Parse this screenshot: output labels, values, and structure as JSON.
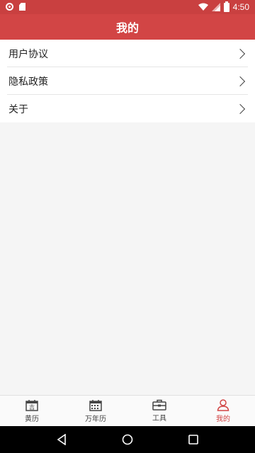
{
  "status": {
    "time": "4:50"
  },
  "header": {
    "title": "我的"
  },
  "menu": {
    "items": [
      {
        "label": "用户协议"
      },
      {
        "label": "隐私政策"
      },
      {
        "label": "关于"
      }
    ]
  },
  "tabs": [
    {
      "label": "黄历",
      "icon": "calendar-ji-icon",
      "active": false
    },
    {
      "label": "万年历",
      "icon": "calendar-grid-icon",
      "active": false
    },
    {
      "label": "工具",
      "icon": "toolbox-icon",
      "active": false
    },
    {
      "label": "我的",
      "icon": "user-icon",
      "active": true
    }
  ],
  "icon_glyphs": {
    "ji": "吉"
  },
  "colors": {
    "accent": "#d24545",
    "status_bar": "#c94040"
  }
}
